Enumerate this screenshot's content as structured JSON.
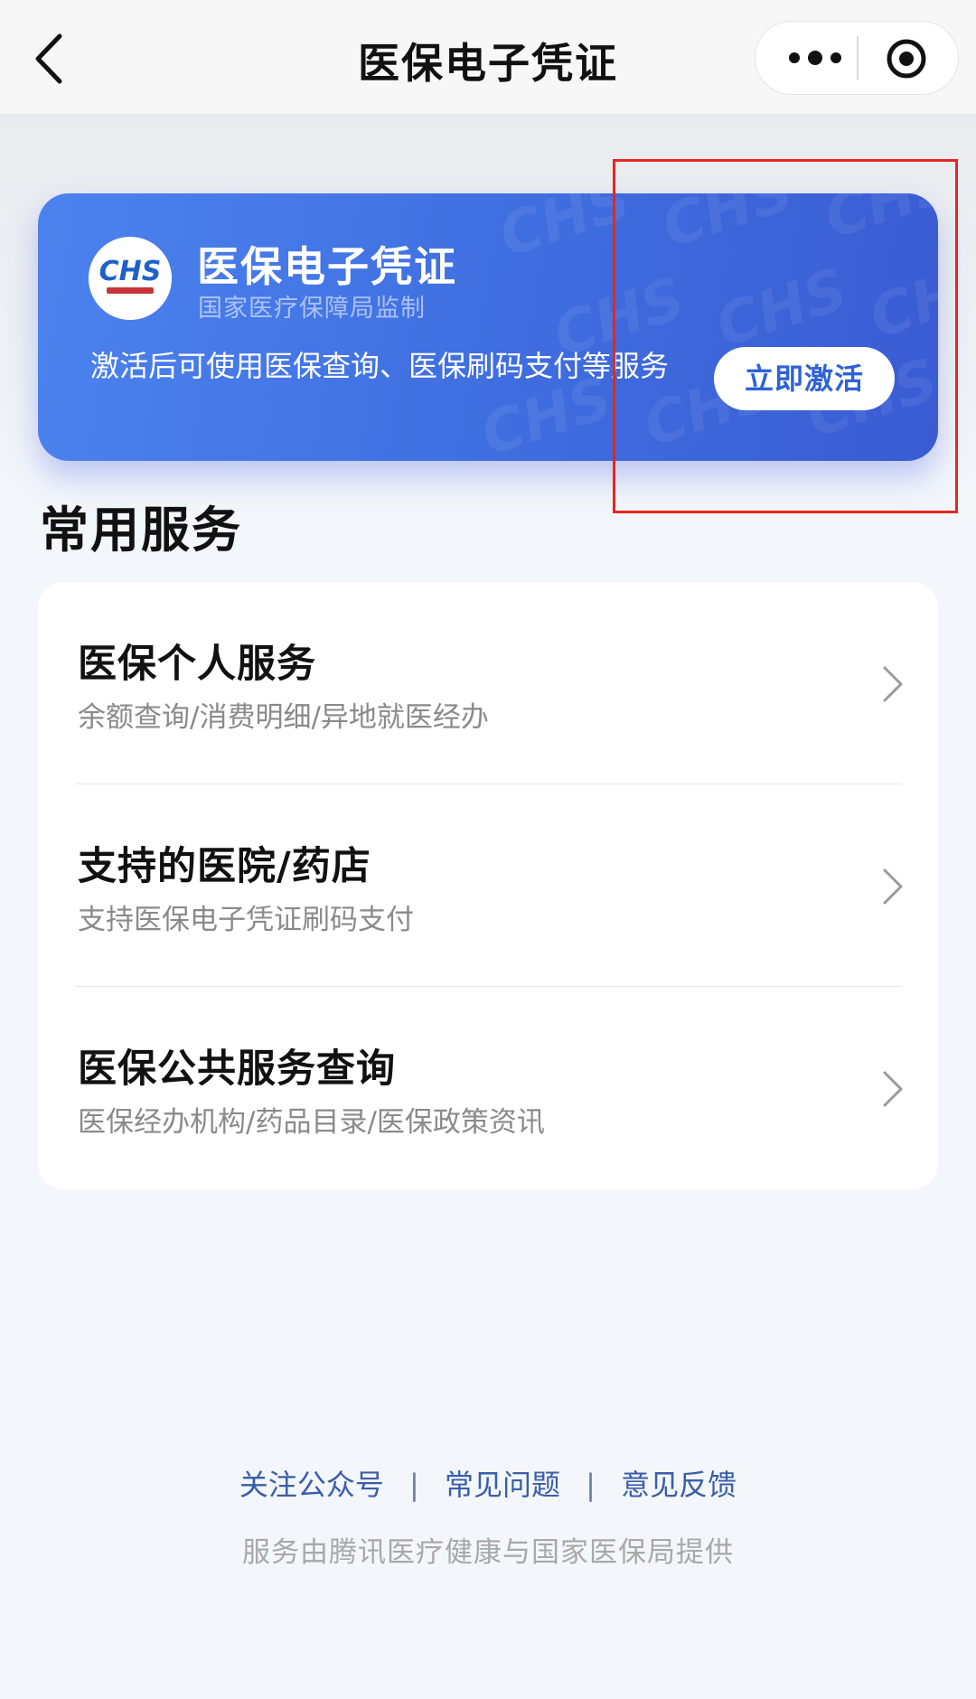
{
  "nav": {
    "title": "医保电子凭证",
    "icons": {
      "back": "back-chevron-icon",
      "more": "more-dots-icon",
      "close": "target-close-icon"
    }
  },
  "card": {
    "title": "医保电子凭证",
    "subtitle": "国家医疗保障局监制",
    "description": "激活后可使用医保查询、医保刷码支付等服务",
    "button_label": "立即激活",
    "logo_icon": "chs-logo-icon",
    "logo_text": "CHS",
    "colors": {
      "gradient_start": "#4c83ee",
      "gradient_end": "#3a5bd3",
      "button_text": "#2f62d8"
    }
  },
  "services": {
    "title": "常用服务",
    "items": [
      {
        "name": "医保个人服务",
        "desc": "余额查询/消费明细/异地就医经办"
      },
      {
        "name": "支持的医院/药店",
        "desc": "支持医保电子凭证刷码支付"
      },
      {
        "name": "医保公共服务查询",
        "desc": "医保经办机构/药品目录/医保政策资讯"
      }
    ]
  },
  "footer": {
    "links": [
      "关注公众号",
      "常见问题",
      "意见反馈"
    ],
    "separator": "|",
    "note": "服务由腾讯医疗健康与国家医保局提供",
    "link_color": "#3a5ea8"
  },
  "annotation": {
    "color": "#e8261e"
  }
}
